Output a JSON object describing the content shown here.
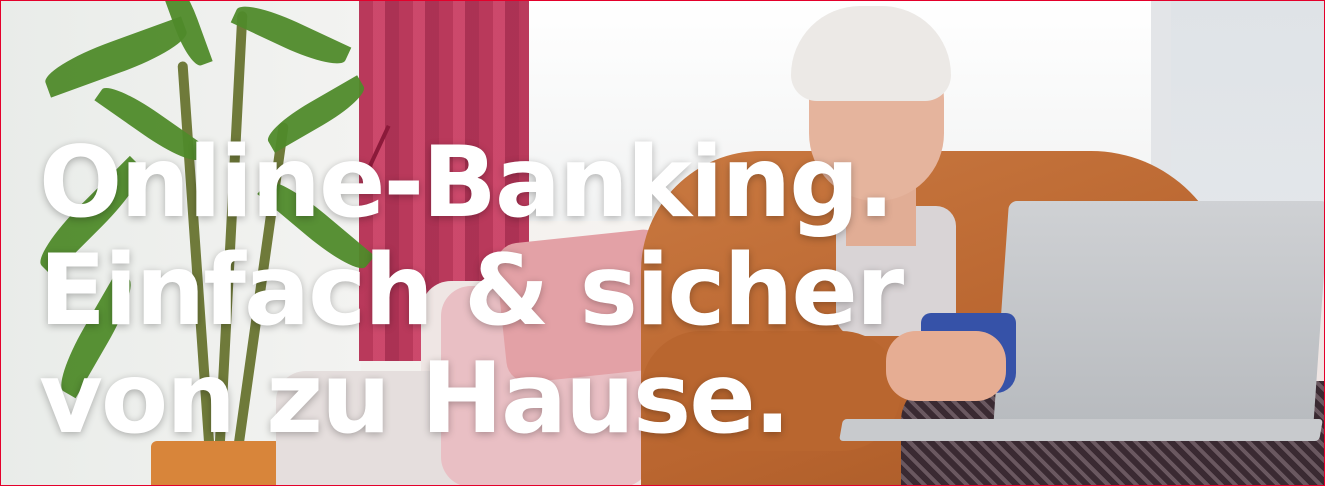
{
  "banner": {
    "headline_lines": [
      "Online-Banking.",
      "Einfach & sicher",
      "von zu Hause."
    ],
    "frame_color": "#e4002b",
    "headline_color": "#ffffff"
  },
  "photo": {
    "subject": "woman-with-laptop-and-mug-on-sofa"
  }
}
